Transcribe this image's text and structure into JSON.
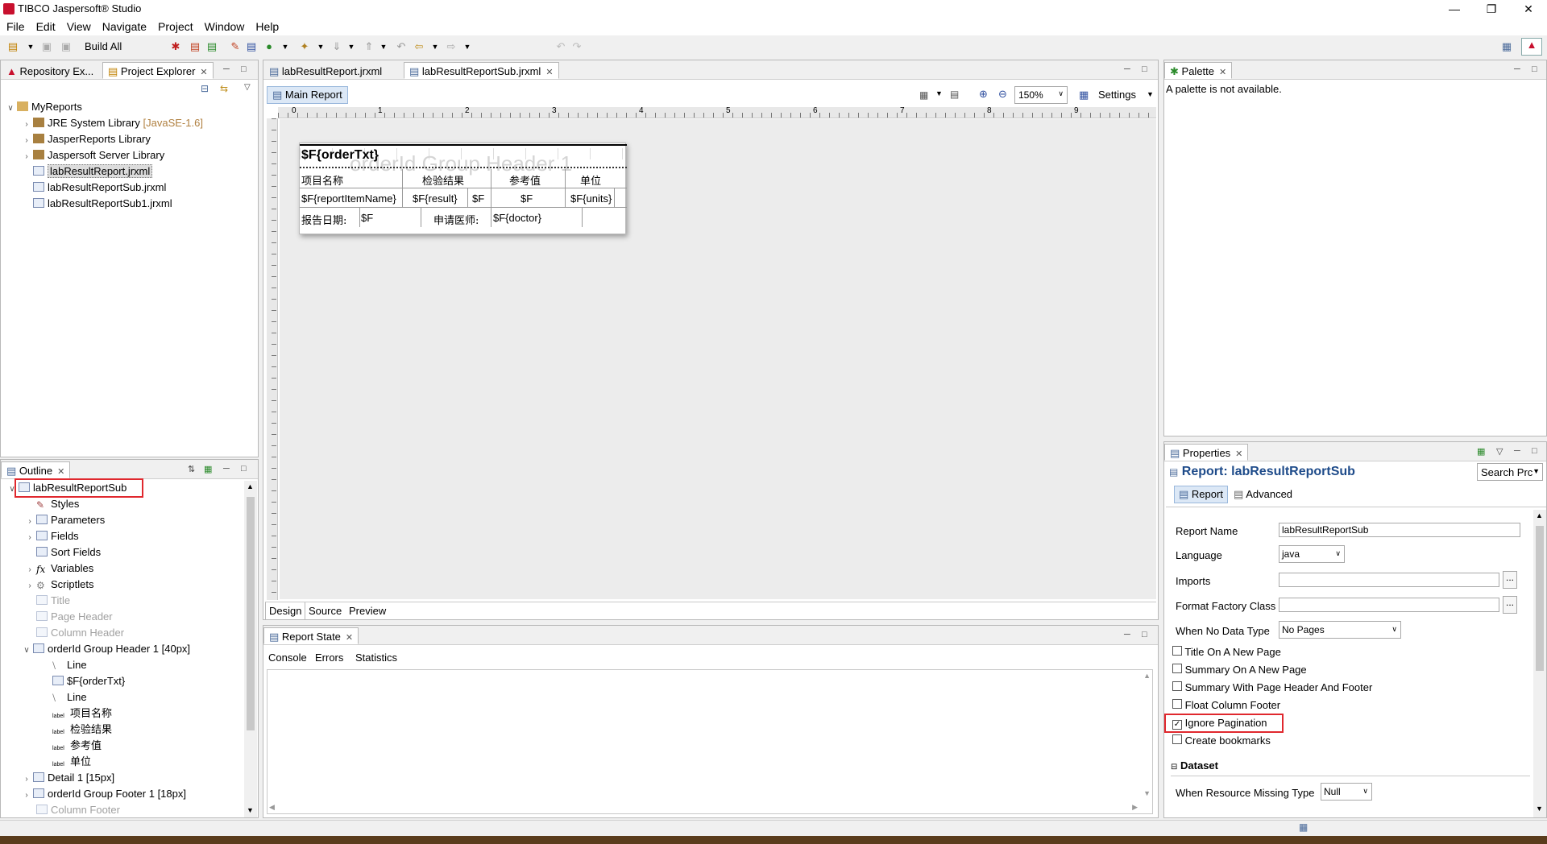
{
  "window": {
    "title": "TIBCO Jaspersoft® Studio"
  },
  "menu": [
    "File",
    "Edit",
    "View",
    "Navigate",
    "Project",
    "Window",
    "Help"
  ],
  "toolbar": {
    "build_all": "Build All"
  },
  "explorer": {
    "tabs": [
      "Repository Ex...",
      "Project Explorer"
    ],
    "root": "MyReports",
    "items": [
      {
        "label": "JRE System Library",
        "suffix": "[JavaSE-1.6]"
      },
      {
        "label": "JasperReports Library"
      },
      {
        "label": "Jaspersoft Server Library"
      },
      {
        "label": "labResultReport.jrxml"
      },
      {
        "label": "labResultReportSub.jrxml"
      },
      {
        "label": "labResultReportSub1.jrxml"
      }
    ]
  },
  "outline": {
    "tab": "Outline",
    "root": "labResultReportSub",
    "items": [
      {
        "label": "Styles"
      },
      {
        "label": "Parameters"
      },
      {
        "label": "Fields"
      },
      {
        "label": "Sort Fields"
      },
      {
        "label": "Variables"
      },
      {
        "label": "Scriptlets"
      },
      {
        "label": "Title"
      },
      {
        "label": "Page Header"
      },
      {
        "label": "Column Header"
      },
      {
        "label": "orderId Group Header 1 [40px]"
      },
      {
        "label": "Line"
      },
      {
        "label": "$F{orderTxt}"
      },
      {
        "label": "Line"
      },
      {
        "label": "项目名称"
      },
      {
        "label": "检验结果"
      },
      {
        "label": "参考值"
      },
      {
        "label": "单位"
      },
      {
        "label": "Detail 1 [15px]"
      },
      {
        "label": "orderId Group Footer 1 [18px]"
      },
      {
        "label": "Column Footer"
      }
    ]
  },
  "editor": {
    "tabs": [
      "labResultReport.jrxml",
      "labResultReportSub.jrxml"
    ],
    "main_report": "Main Report",
    "zoom": "150%",
    "settings": "Settings",
    "ruler": [
      "0",
      "1",
      "2",
      "3",
      "4",
      "5",
      "6",
      "7",
      "8",
      "9"
    ],
    "report": {
      "order_txt": "$F{orderTxt}",
      "group_watermark": "orderId Group Header 1",
      "headers": [
        "项目名称",
        "检验结果",
        "参考值",
        "单位"
      ],
      "detail": [
        "$F{reportItemName}",
        "$F{result}",
        "$F",
        "$F",
        "$F{units}"
      ],
      "footer": [
        "报告日期:",
        "$F",
        "申请医师:",
        "$F{doctor}"
      ]
    },
    "bottom_tabs": [
      "Design",
      "Source",
      "Preview"
    ]
  },
  "report_state": {
    "tab": "Report State",
    "subtabs": [
      "Console",
      "Errors",
      "Statistics"
    ]
  },
  "palette": {
    "tab": "Palette",
    "message": "A palette is not available."
  },
  "properties": {
    "tab": "Properties",
    "title": "Report: labResultReportSub",
    "search": "Search Prc",
    "subtabs": [
      "Report",
      "Advanced"
    ],
    "fields": {
      "report_name_label": "Report Name",
      "report_name": "labResultReportSub",
      "language_label": "Language",
      "language": "java",
      "imports_label": "Imports",
      "imports": "",
      "format_factory_label": "Format Factory Class",
      "format_factory": "",
      "when_no_data_label": "When No Data Type",
      "when_no_data": "No Pages"
    },
    "checkboxes": [
      {
        "label": "Title On A New Page",
        "checked": false
      },
      {
        "label": "Summary On A New Page",
        "checked": false
      },
      {
        "label": "Summary With Page Header And Footer",
        "checked": false
      },
      {
        "label": "Float Column Footer",
        "checked": false
      },
      {
        "label": "Ignore Pagination",
        "checked": true
      },
      {
        "label": "Create bookmarks",
        "checked": false
      }
    ],
    "dataset": {
      "header": "Dataset",
      "missing_label": "When Resource Missing Type",
      "missing": "Null"
    },
    "browse_button": "..."
  },
  "colors": {
    "highlight": "#e0282e",
    "link_blue": "#1e4b8a"
  }
}
